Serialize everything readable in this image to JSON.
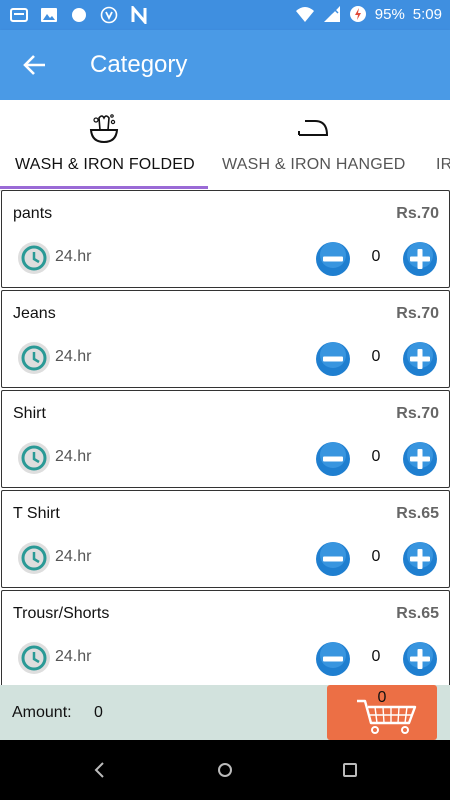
{
  "status_bar": {
    "battery": "95%",
    "time": "5:09",
    "icons": [
      "message-icon",
      "image-icon",
      "circle-icon",
      "shield-icon",
      "n-icon",
      "wifi-icon",
      "signal-icon",
      "battery-icon"
    ]
  },
  "app_bar": {
    "title": "Category",
    "back_icon": "arrow-left-icon"
  },
  "tabs": [
    {
      "label": "WASH & IRON FOLDED",
      "icon": "washing-basin-icon",
      "selected": true
    },
    {
      "label": "WASH & IRON HANGED",
      "icon": "iron-icon",
      "selected": false
    },
    {
      "label": "IR",
      "icon": "",
      "selected": false
    }
  ],
  "items": [
    {
      "name": "pants",
      "price": "Rs.70",
      "duration": "24.hr",
      "qty": "0"
    },
    {
      "name": "Jeans",
      "price": "Rs.70",
      "duration": "24.hr",
      "qty": "0"
    },
    {
      "name": "Shirt",
      "price": "Rs.70",
      "duration": "24.hr",
      "qty": "0"
    },
    {
      "name": "T Shirt",
      "price": "Rs.65",
      "duration": "24.hr",
      "qty": "0"
    },
    {
      "name": "Trousr/Shorts",
      "price": "Rs.65",
      "duration": "24.hr",
      "qty": "0"
    }
  ],
  "footer": {
    "amount_label": "Amount:",
    "amount_value": "0",
    "cart_count": "0"
  },
  "colors": {
    "app_bar": "#4a9ae6",
    "status_bar": "#3f8fe0",
    "tab_indicator": "#9a6ad6",
    "button_blue": "#1f7fd0",
    "clock_teal": "#2a9a96",
    "footer_bg": "#d2e2dd",
    "cart_orange": "#ec6f45"
  }
}
